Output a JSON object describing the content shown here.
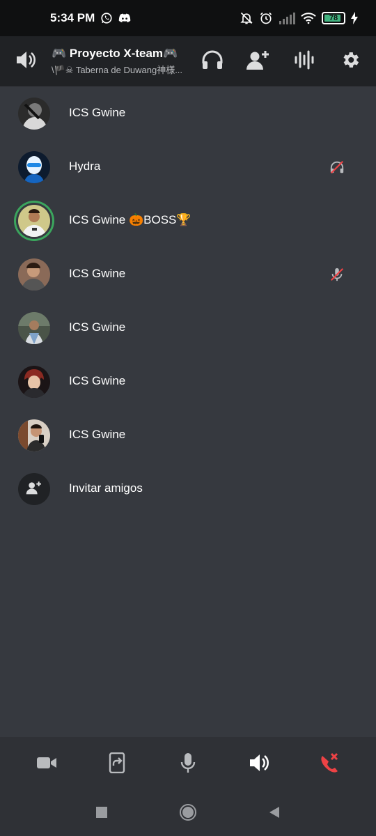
{
  "status_bar": {
    "time": "5:34 PM",
    "battery": "78",
    "icons": [
      "whatsapp-icon",
      "discord-icon",
      "bell-off-icon",
      "alarm-icon",
      "signal-icon",
      "wifi-icon",
      "battery-icon",
      "charging-icon"
    ]
  },
  "header": {
    "title": "🎮 Proyecto X-team🎮",
    "subtitle": "\\🏴☠ Taberna de Duwang神様...",
    "icons": [
      "speaker-icon",
      "headphones-icon",
      "add-user-icon",
      "soundboard-icon",
      "gear-icon"
    ]
  },
  "participants": [
    {
      "name": "ICS Gwine",
      "avatar_color": "#3a3a3a",
      "speaking": false,
      "status_icon": ""
    },
    {
      "name": "Hydra",
      "avatar_color": "#1e5fa8",
      "speaking": false,
      "status_icon": "deafened-icon"
    },
    {
      "name": "ICS  Gwine 🎃BOSS🏆",
      "avatar_color": "#c9c07a",
      "speaking": true,
      "status_icon": ""
    },
    {
      "name": "ICS Gwine",
      "avatar_color": "#8a6a58",
      "speaking": false,
      "status_icon": "muted-icon"
    },
    {
      "name": "ICS Gwine",
      "avatar_color": "#5b6a5a",
      "speaking": false,
      "status_icon": ""
    },
    {
      "name": "ICS Gwine",
      "avatar_color": "#6b2e2a",
      "speaking": false,
      "status_icon": ""
    },
    {
      "name": "ICS Gwine",
      "avatar_color": "#9a8a7a",
      "speaking": false,
      "status_icon": ""
    }
  ],
  "invite": {
    "label": "Invitar amigos",
    "icon": "add-user-icon"
  },
  "controls": {
    "icons": [
      "camera-icon",
      "screen-share-icon",
      "microphone-icon",
      "speaker-icon",
      "hangup-icon"
    ],
    "hangup_color": "#ed4245"
  },
  "colors": {
    "background": "#36393f",
    "header": "#202225",
    "speaking_ring": "#3ba55d",
    "status_red": "#ed4245"
  }
}
